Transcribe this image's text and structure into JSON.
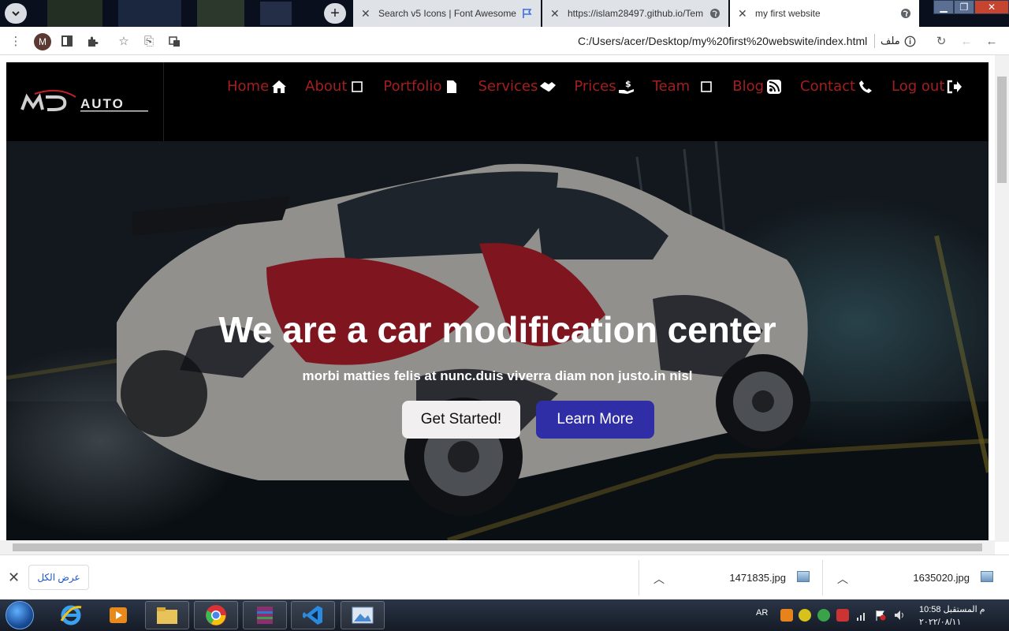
{
  "browser": {
    "tabs": [
      {
        "title": "Search v5 Icons | Font Awesome",
        "active": false
      },
      {
        "title": "https://islam28497.github.io/Tem",
        "active": false
      },
      {
        "title": "my first website",
        "active": true
      }
    ],
    "profile_initial": "M",
    "url": "C:/Users/acer/Desktop/my%20first%20webswite/index.html",
    "url_chip": "ملف"
  },
  "site": {
    "logo_text": "AUTO",
    "nav": [
      {
        "label": "Home",
        "icon": "home-icon"
      },
      {
        "label": "About",
        "icon": "square-icon"
      },
      {
        "label": "Portfolio",
        "icon": "file-icon"
      },
      {
        "label": "Services",
        "icon": "handshake-icon"
      },
      {
        "label": "Prices",
        "icon": "hand-dollar-icon"
      },
      {
        "label": "Team",
        "icon": "square-icon"
      },
      {
        "label": "Blog",
        "icon": "rss-icon"
      },
      {
        "label": "Contact",
        "icon": "phone-icon"
      },
      {
        "label": "Log out",
        "icon": "sign-out-icon"
      }
    ],
    "hero": {
      "title": "We are a car modification center",
      "subtitle": "morbi matties felis at nunc.duis viverra diam non justo.in nisl",
      "primary_button": "Get Started!",
      "secondary_button": "Learn More"
    }
  },
  "downloads": {
    "show_all": "عرض الكل",
    "items": [
      {
        "filename": "1471835.jpg"
      },
      {
        "filename": "1635020.jpg"
      }
    ]
  },
  "taskbar": {
    "language": "AR",
    "time": "10:58 م المستقبل",
    "date": "٢٠٢٢/٠٨/١١"
  },
  "colors": {
    "nav_text": "#a41e1e",
    "learn_more_bg": "#2f2ea6",
    "header_bg": "#000000"
  }
}
